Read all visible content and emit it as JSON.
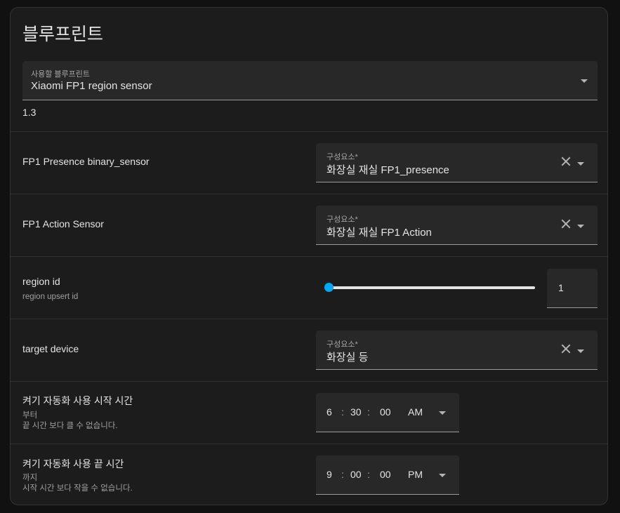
{
  "title": "블루프린트",
  "blueprint": {
    "label": "사용할 블루프린트",
    "value": "Xiaomi FP1 region sensor",
    "version": "1.3"
  },
  "rows": {
    "presence": {
      "label": "FP1 Presence binary_sensor",
      "field_label": "구성요소*",
      "value": "화장실 재실 FP1_presence"
    },
    "action": {
      "label": "FP1 Action Sensor",
      "field_label": "구성요소*",
      "value": "화장실 재실 FP1 Action"
    },
    "region": {
      "label": "region id",
      "description": "region upsert id",
      "value": "1",
      "slider_fraction": 0.0
    },
    "target": {
      "label": "target device",
      "field_label": "구성요소*",
      "value": "화장실 등"
    },
    "start_time": {
      "label": "켜기 자동화 사용 시작 시간",
      "description_line1": "부터",
      "description_line2": "끝 시간 보다 클 수 없습니다.",
      "hours": "6",
      "minutes": "30",
      "seconds": "00",
      "ampm": "AM"
    },
    "end_time": {
      "label": "켜기 자동화 사용 끝 시간",
      "description_line1": "까지",
      "description_line2": "시작 시간 보다 작을 수 없습니다.",
      "hours": "9",
      "minutes": "00",
      "seconds": "00",
      "ampm": "PM"
    }
  },
  "separators": {
    "colon": ":"
  },
  "colors": {
    "accent": "#03a9f4",
    "card_bg": "#1c1c1c",
    "field_bg": "#282828"
  }
}
